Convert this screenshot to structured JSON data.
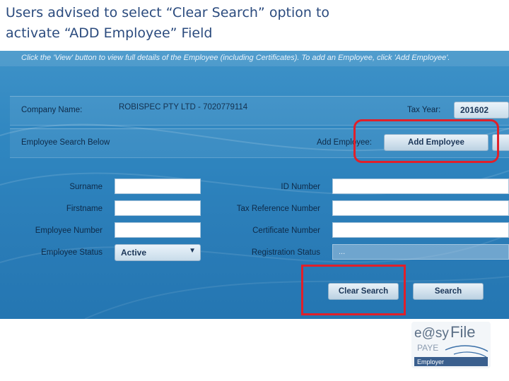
{
  "slide": {
    "title_line1": "Users advised to select “Clear Search” option to",
    "title_line2": "activate “ADD Employee”  Field"
  },
  "app": {
    "info_text": "Click the 'View' button to view full details of the Employee (including Certificates). To add an Employee, click 'Add Employee'.",
    "company": {
      "label": "Company Name:",
      "value": "ROBISPEC PTY LTD - 7020779114"
    },
    "tax_year": {
      "label": "Tax Year:",
      "value": "201602"
    },
    "employee_search_label": "Employee Search Below",
    "add_employee": {
      "label": "Add Employee:",
      "button": "Add Employee"
    },
    "fields_left": [
      {
        "label": "Surname",
        "value": ""
      },
      {
        "label": "Firstname",
        "value": ""
      },
      {
        "label": "Employee Number",
        "value": ""
      }
    ],
    "employee_status": {
      "label": "Employee Status",
      "value": "Active"
    },
    "fields_right": [
      {
        "label": "ID Number",
        "value": ""
      },
      {
        "label": "Tax Reference Number",
        "value": ""
      },
      {
        "label": "Certificate Number",
        "value": ""
      }
    ],
    "registration_status": {
      "label": "Registration Status",
      "value": "..."
    },
    "buttons": {
      "clear_search": "Clear Search",
      "search": "Search"
    }
  },
  "logo": {
    "brand": "e@syFile",
    "sub": "PAYE",
    "badge": "Employer"
  },
  "colors": {
    "panel": "#2f86c0",
    "highlight": "#e0202a",
    "title": "#2b4b7e"
  }
}
